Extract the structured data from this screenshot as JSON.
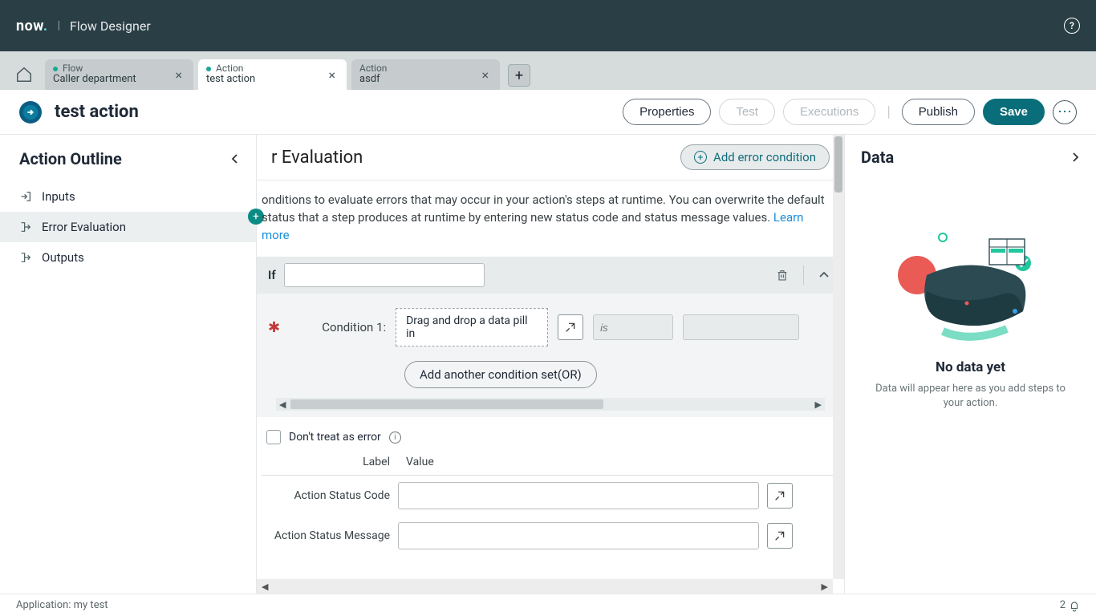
{
  "header": {
    "logo": "now",
    "product": "Flow Designer",
    "help_tooltip": "?"
  },
  "tabs": [
    {
      "type": "Flow",
      "title": "Caller department",
      "modified": true,
      "active": false
    },
    {
      "type": "Action",
      "title": "test action",
      "modified": true,
      "active": true
    },
    {
      "type": "Action",
      "title": "asdf",
      "modified": false,
      "active": false
    }
  ],
  "action_bar": {
    "name": "test action",
    "buttons": {
      "properties": "Properties",
      "test": "Test",
      "executions": "Executions",
      "publish": "Publish",
      "save": "Save"
    }
  },
  "outline": {
    "title": "Action Outline",
    "items": [
      {
        "label": "Inputs",
        "icon": "input-icon",
        "selected": false
      },
      {
        "label": "Error Evaluation",
        "icon": "error-eval-icon",
        "selected": true
      },
      {
        "label": "Outputs",
        "icon": "output-icon",
        "selected": false
      }
    ]
  },
  "error_eval": {
    "heading_visible": "r Evaluation",
    "add_button": "Add error condition",
    "description_visible": "onditions to evaluate errors that may occur in your action's steps at runtime. You can overwrite the default status that a step produces at runtime by entering new status code and status message values. ",
    "learn_more": "Learn more",
    "if_label": "If",
    "condition_label": "Condition 1:",
    "pill_placeholder": "Drag and drop a data pill in",
    "operator_placeholder": "is",
    "add_condition_set": "Add another condition set(OR)",
    "treat_label": "Don't treat as error",
    "label_header": "Label",
    "value_header": "Value",
    "fields": [
      {
        "label": "Action Status Code",
        "value": ""
      },
      {
        "label": "Action Status Message",
        "value": ""
      }
    ]
  },
  "data_panel": {
    "title": "Data",
    "no_data_title": "No data yet",
    "no_data_body": "Data will appear here as you add steps to your action."
  },
  "footer": {
    "application_label": "Application: my test",
    "notif_count": "2"
  }
}
